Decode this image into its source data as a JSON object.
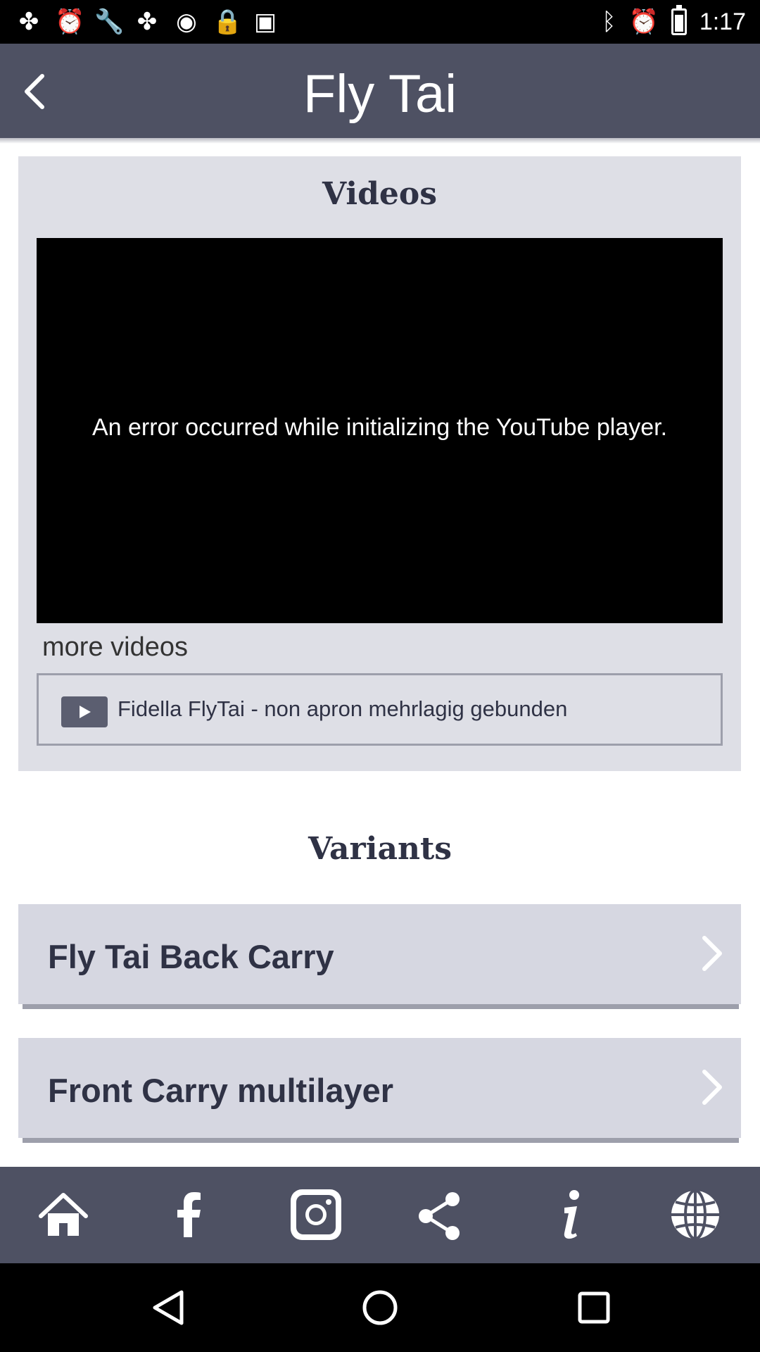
{
  "status_bar": {
    "time": "1:17",
    "left_icons": [
      "fidget-icon",
      "alarm-icon",
      "wrench-icon",
      "fidget-icon",
      "dot-icon",
      "lock-icon",
      "android-icon"
    ],
    "right_icons": [
      "bluetooth-icon",
      "alarm-icon",
      "battery-icon"
    ]
  },
  "header": {
    "title": "Fly Tai",
    "back_icon": "back-arrow-icon"
  },
  "videos": {
    "heading": "Videos",
    "player_error": "An error occurred while initializing the YouTube player.",
    "more_label": "more videos",
    "items": [
      {
        "title": "Fidella FlyTai - non apron mehrlagig gebunden",
        "icon": "play-icon"
      }
    ]
  },
  "variants": {
    "heading": "Variants",
    "items": [
      {
        "label": "Fly Tai Back Carry"
      },
      {
        "label": "Front Carry multilayer"
      }
    ]
  },
  "bottom_bar": {
    "icons": [
      "home-icon",
      "facebook-icon",
      "instagram-icon",
      "share-icon",
      "info-icon",
      "globe-icon"
    ]
  },
  "nav_bar": {
    "buttons": [
      "back-triangle-icon",
      "home-circle-icon",
      "recents-square-icon"
    ]
  },
  "colors": {
    "app_bar": "#4e5163",
    "card": "#dedfe6",
    "variant": "#d6d7e1",
    "text_dark": "#2f3245"
  }
}
